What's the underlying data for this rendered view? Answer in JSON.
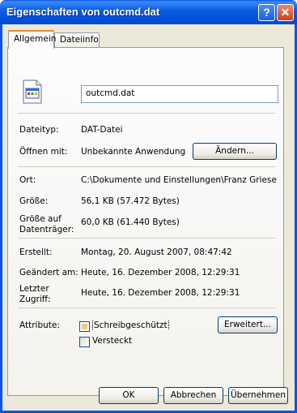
{
  "window": {
    "title": "Eigenschaften von outcmd.dat",
    "help_label": "?",
    "close_label": "✕"
  },
  "tabs": [
    {
      "label": "Allgemein",
      "active": true
    },
    {
      "label": "Dateiinfo",
      "active": false
    }
  ],
  "general": {
    "filename": "outcmd.dat",
    "file_icon": "dat-file-icon",
    "rows": {
      "type": {
        "label": "Dateityp:",
        "value": "DAT-Datei"
      },
      "opens_with": {
        "label": "Öffnen mit:",
        "value": "Unbekannte Anwendung",
        "button": "Ändern..."
      },
      "location": {
        "label": "Ort:",
        "value": "C:\\Dokumente und Einstellungen\\Franz Grieser\\An"
      },
      "size": {
        "label": "Größe:",
        "value": "56,1 KB (57.472 Bytes)"
      },
      "size_on_disk": {
        "label_line1": "Größe auf",
        "label_line2": "Datenträger:",
        "value": "60,0 KB (61.440 Bytes)"
      },
      "created": {
        "label": "Erstellt:",
        "value": "Montag, 20. August 2007, 08:47:42"
      },
      "modified": {
        "label": "Geändert am:",
        "value": "Heute, 16. Dezember 2008, 12:29:31"
      },
      "accessed": {
        "label_line1": "Letzter",
        "label_line2": "Zugriff:",
        "value": "Heute, 16. Dezember 2008, 12:29:31"
      }
    },
    "attributes": {
      "label": "Attribute:",
      "readonly": "Schreibgeschützt",
      "hidden": "Versteckt",
      "advanced_button": "Erweitert..."
    }
  },
  "footer": {
    "ok": "OK",
    "cancel": "Abbrechen",
    "apply": "Übernehmen"
  }
}
